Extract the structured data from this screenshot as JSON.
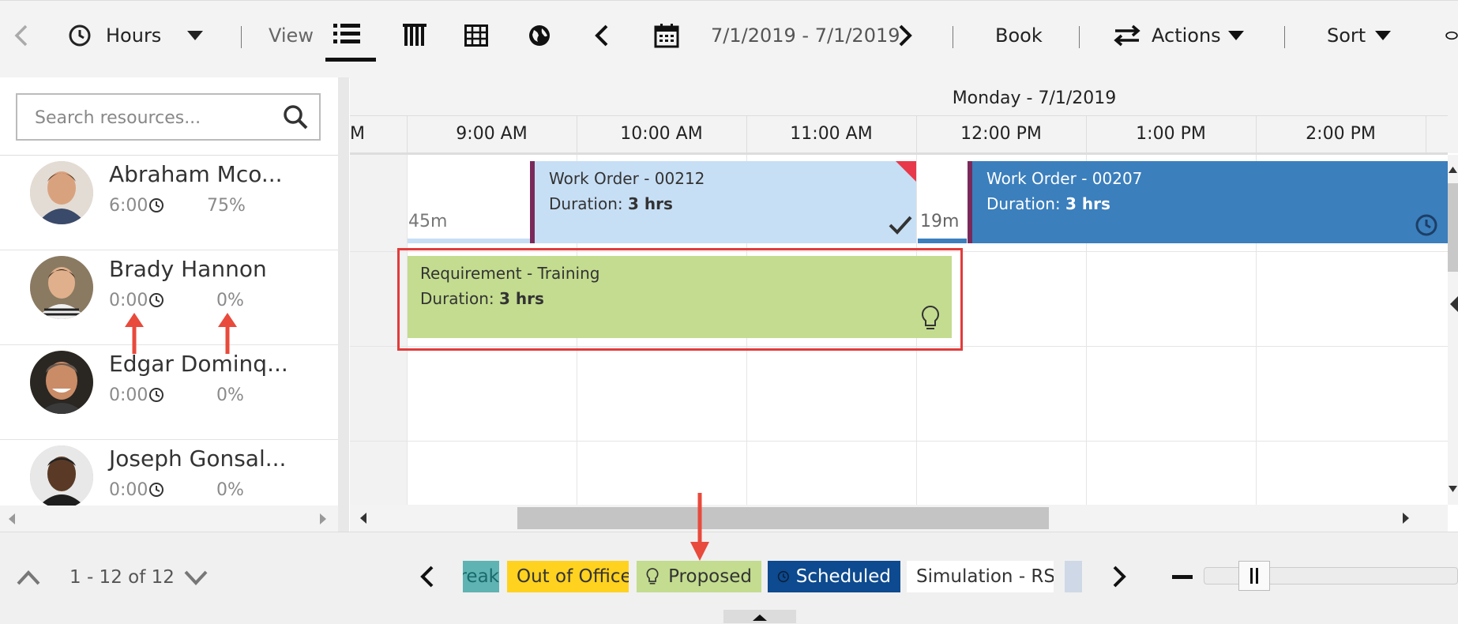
{
  "toolbar": {
    "hours_label": "Hours",
    "view_label": "View",
    "date_range": "7/1/2019 - 7/1/2019",
    "book_label": "Book",
    "actions_label": "Actions",
    "sort_label": "Sort"
  },
  "search": {
    "placeholder": "Search resources..."
  },
  "resources": [
    {
      "name": "Abraham Mco...",
      "hours": "6:00",
      "percent": "75%"
    },
    {
      "name": "Brady Hannon",
      "hours": "0:00",
      "percent": "0%"
    },
    {
      "name": "Edgar Dominq...",
      "hours": "0:00",
      "percent": "0%"
    },
    {
      "name": "Joseph Gonsal...",
      "hours": "0:00",
      "percent": "0%"
    }
  ],
  "schedule": {
    "day_label": "Monday - 7/1/2019",
    "partial_time": "M",
    "times": [
      "9:00 AM",
      "10:00 AM",
      "11:00 AM",
      "12:00 PM",
      "1:00 PM",
      "2:00 PM"
    ],
    "bookings": [
      {
        "title": "Work Order - 00212",
        "duration_label": "Duration:",
        "duration_value": "3 hrs",
        "travel": "45m"
      },
      {
        "title": "Work Order - 00207",
        "duration_label": "Duration:",
        "duration_value": "3 hrs",
        "travel": "19m"
      },
      {
        "title": "Requirement - Training",
        "duration_label": "Duration:",
        "duration_value": "3 hrs"
      }
    ]
  },
  "footer": {
    "pagination": "1 - 12 of 12",
    "legend": [
      {
        "label": "reak",
        "color": "#5fb3b3"
      },
      {
        "label": "Out of Office",
        "color": "#ffd21f"
      },
      {
        "label": "Proposed",
        "color": "#c3dc8f"
      },
      {
        "label": "Scheduled",
        "color": "#0d4a8f"
      },
      {
        "label": "Simulation - RSO",
        "color": "#ffffff"
      }
    ]
  },
  "colors": {
    "highlight": "#e23b3b",
    "light_booking": "#c7dff5",
    "dark_booking": "#3b7fbd",
    "proposed": "#c3dc8f"
  }
}
